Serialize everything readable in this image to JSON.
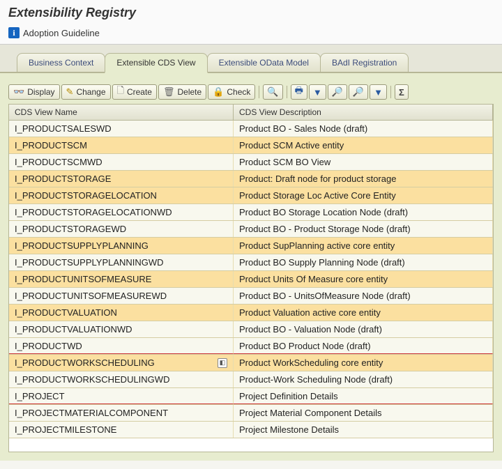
{
  "header": {
    "title": "Extensibility Registry",
    "guideline_label": "Adoption Guideline"
  },
  "tabs": {
    "items": [
      {
        "label": "Business Context",
        "active": false
      },
      {
        "label": "Extensible CDS View",
        "active": true
      },
      {
        "label": "Extensible OData Model",
        "active": false
      },
      {
        "label": "BAdI Registration",
        "active": false
      }
    ]
  },
  "toolbar": {
    "display": "Display",
    "change": "Change",
    "create": "Create",
    "delete": "Delete",
    "check": "Check"
  },
  "grid": {
    "headers": {
      "name": "CDS View Name",
      "desc": "CDS View Description"
    },
    "rows": [
      {
        "name": "I_PRODUCTSALESWD",
        "desc": "Product BO - Sales Node (draft)",
        "hl": false,
        "red": false,
        "vh": false
      },
      {
        "name": "I_PRODUCTSCM",
        "desc": "Product SCM Active entity",
        "hl": true,
        "red": false,
        "vh": false
      },
      {
        "name": "I_PRODUCTSCMWD",
        "desc": "Product SCM BO View",
        "hl": false,
        "red": false,
        "vh": false
      },
      {
        "name": "I_PRODUCTSTORAGE",
        "desc": "Product: Draft node for product storage",
        "hl": true,
        "red": false,
        "vh": false
      },
      {
        "name": "I_PRODUCTSTORAGELOCATION",
        "desc": "Product Storage Loc Active Core Entity",
        "hl": true,
        "red": false,
        "vh": false
      },
      {
        "name": "I_PRODUCTSTORAGELOCATIONWD",
        "desc": "Product BO Storage Location Node (draft)",
        "hl": false,
        "red": false,
        "vh": false
      },
      {
        "name": "I_PRODUCTSTORAGEWD",
        "desc": "Product BO - Product Storage Node (draft)",
        "hl": false,
        "red": false,
        "vh": false
      },
      {
        "name": "I_PRODUCTSUPPLYPLANNING",
        "desc": "Product SupPlanning active core entity",
        "hl": true,
        "red": false,
        "vh": false
      },
      {
        "name": "I_PRODUCTSUPPLYPLANNINGWD",
        "desc": "Product BO Supply Planning Node (draft)",
        "hl": false,
        "red": false,
        "vh": false
      },
      {
        "name": "I_PRODUCTUNITSOFMEASURE",
        "desc": "Product Units Of Measure core entity",
        "hl": true,
        "red": false,
        "vh": false
      },
      {
        "name": "I_PRODUCTUNITSOFMEASUREWD",
        "desc": "Product BO - UnitsOfMeasure Node (draft)",
        "hl": false,
        "red": false,
        "vh": false
      },
      {
        "name": "I_PRODUCTVALUATION",
        "desc": "Product Valuation active core entity",
        "hl": true,
        "red": false,
        "vh": false
      },
      {
        "name": "I_PRODUCTVALUATIONWD",
        "desc": "Product BO - Valuation Node (draft)",
        "hl": false,
        "red": false,
        "vh": false
      },
      {
        "name": "I_PRODUCTWD",
        "desc": "Product BO Product Node (draft)",
        "hl": false,
        "red": true,
        "vh": false
      },
      {
        "name": "I_PRODUCTWORKSCHEDULING",
        "desc": "Product WorkScheduling core entity",
        "hl": true,
        "red": false,
        "vh": true
      },
      {
        "name": "I_PRODUCTWORKSCHEDULINGWD",
        "desc": "Product-Work Scheduling Node (draft)",
        "hl": false,
        "red": false,
        "vh": false
      },
      {
        "name": "I_PROJECT",
        "desc": "Project Definition Details",
        "hl": false,
        "red": true,
        "vh": false
      },
      {
        "name": "I_PROJECTMATERIALCOMPONENT",
        "desc": "Project Material Component Details",
        "hl": false,
        "red": false,
        "vh": false
      },
      {
        "name": "I_PROJECTMILESTONE",
        "desc": "Project Milestone Details",
        "hl": false,
        "red": false,
        "vh": false
      }
    ]
  }
}
